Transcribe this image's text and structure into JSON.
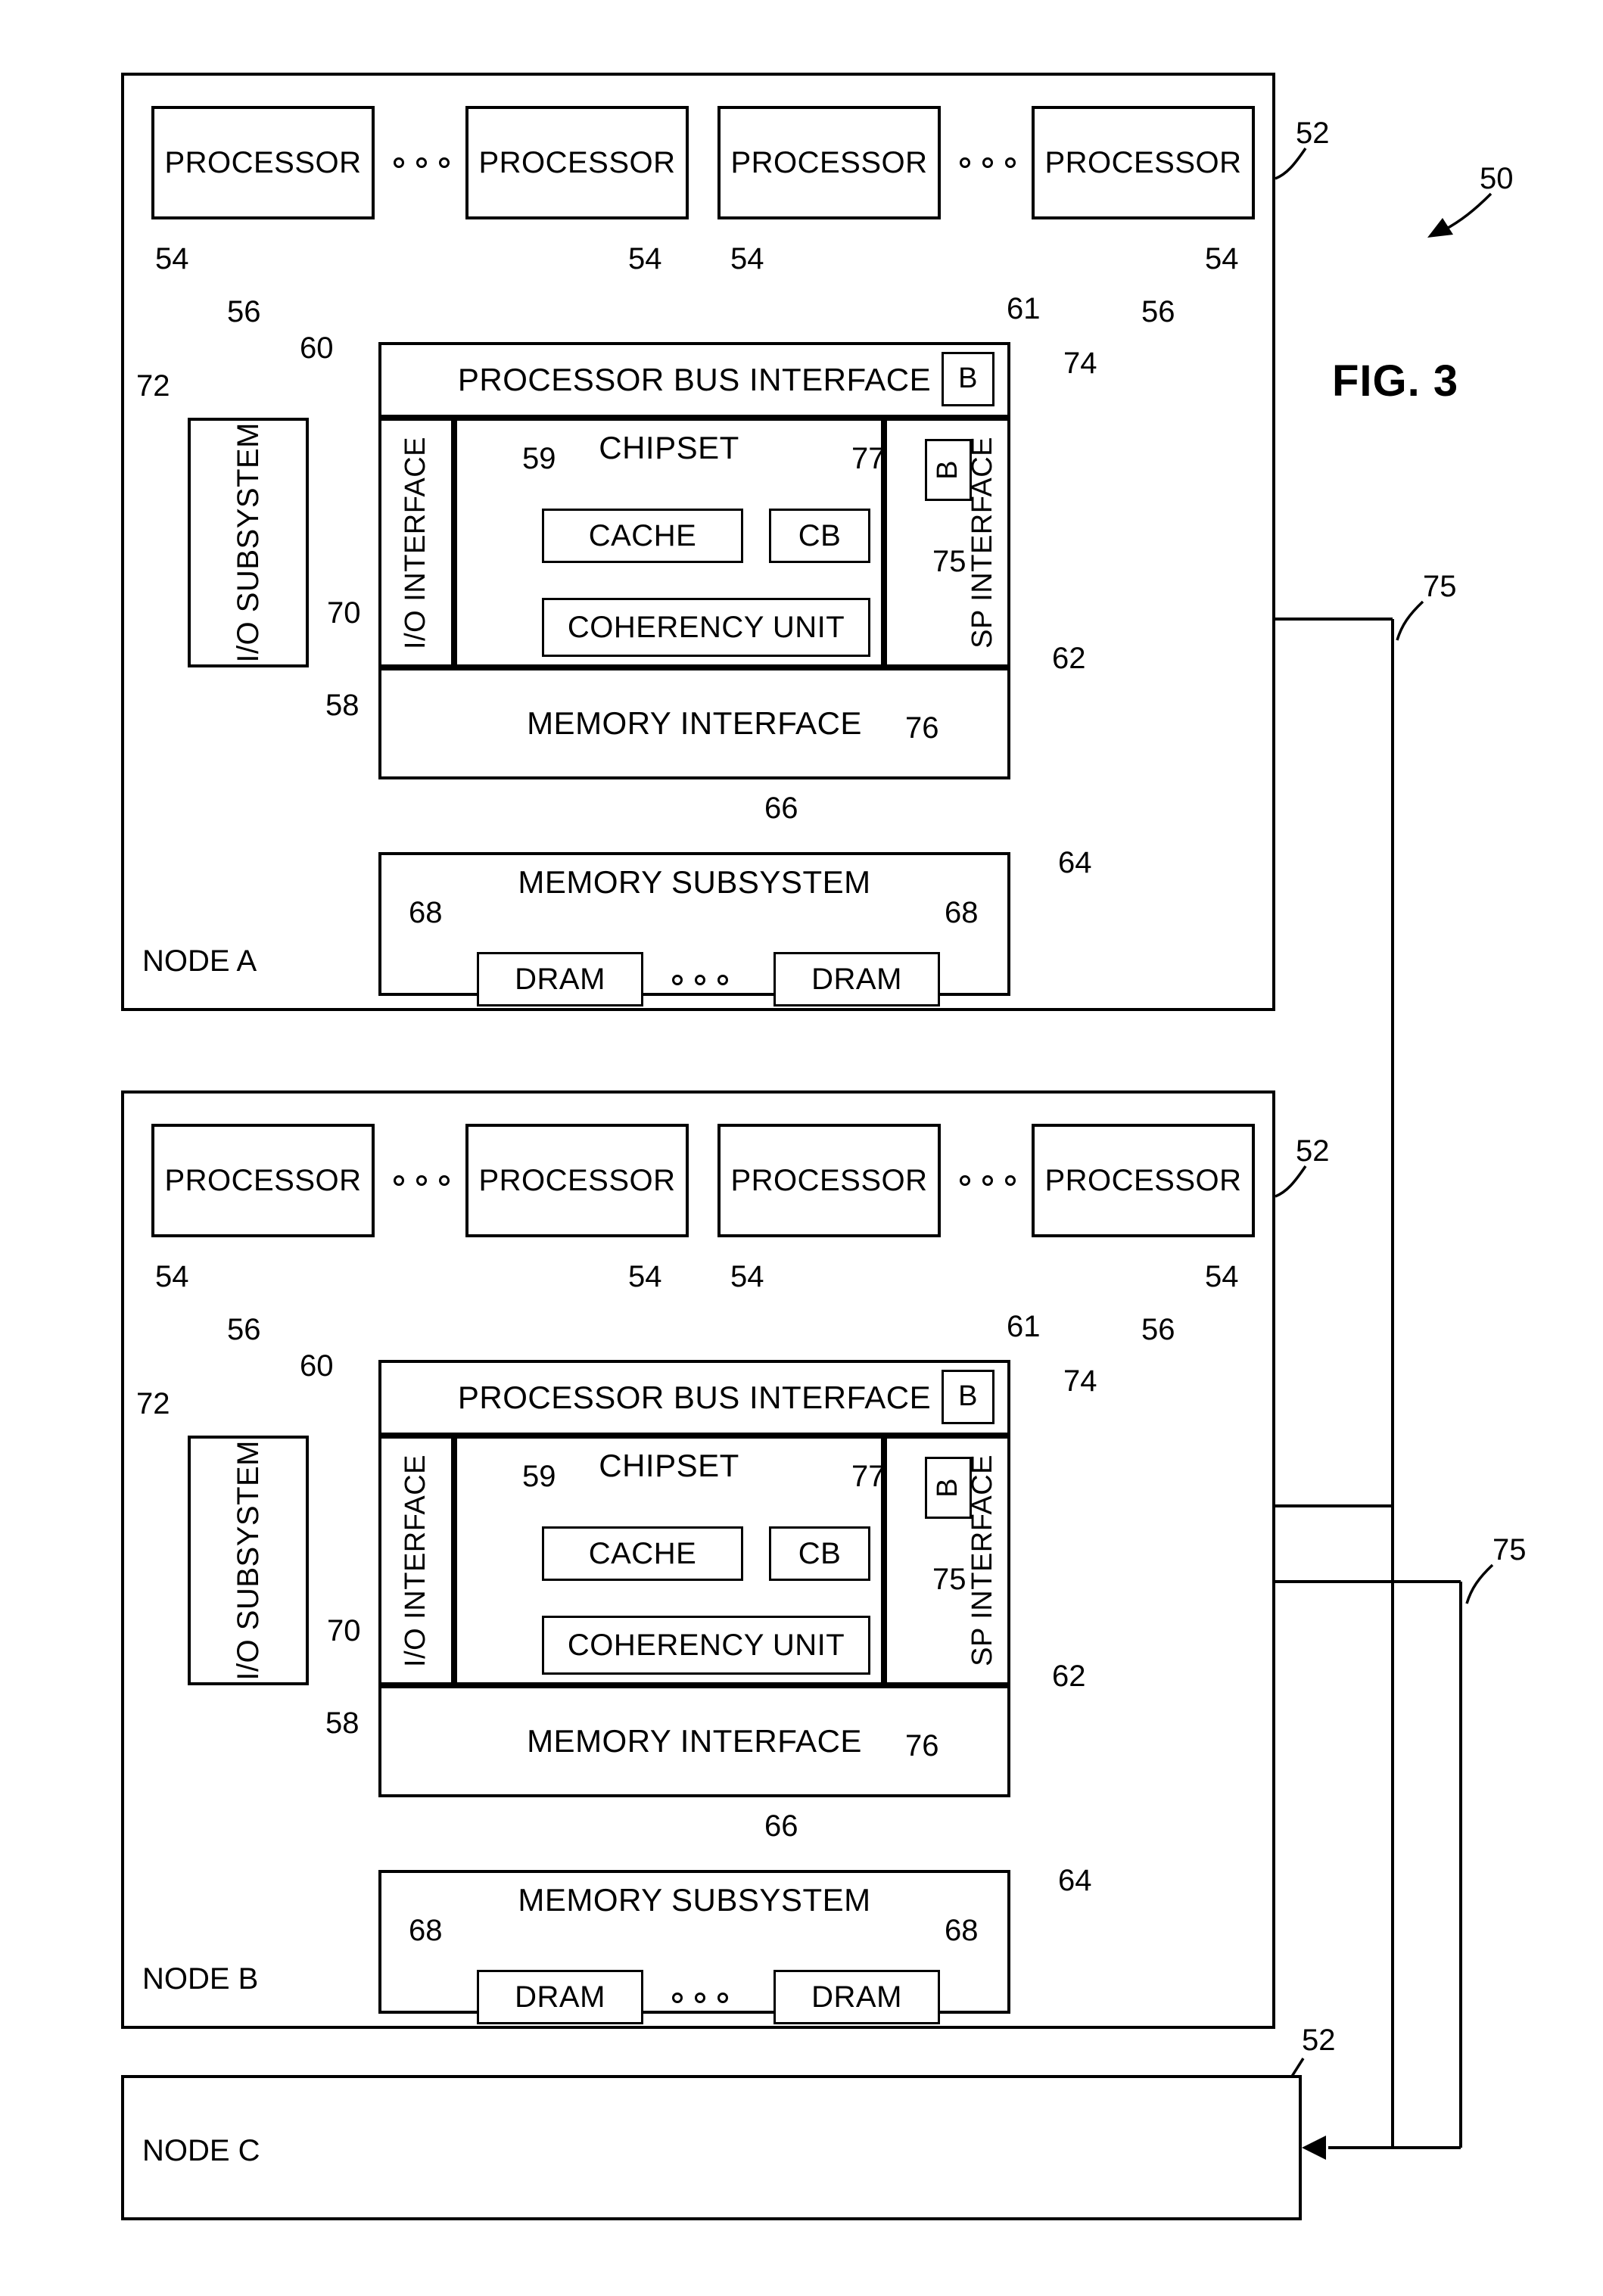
{
  "figure": {
    "title": "FIG. 3",
    "system_ref": "50"
  },
  "nodes": [
    {
      "name": "NODE A",
      "ref": "52",
      "processors": [
        {
          "label": "PROCESSOR",
          "ref": "54"
        },
        {
          "label": "PROCESSOR",
          "ref": "54"
        },
        {
          "label": "PROCESSOR",
          "ref": "54"
        },
        {
          "label": "PROCESSOR",
          "ref": "54"
        }
      ],
      "processor_ellipsis": "o o o",
      "bus_ref_left": "56",
      "bus_ref_right": "56",
      "bus_to_chipset_ref": "60",
      "chipset_container": {
        "processor_bus_interface": {
          "label": "PROCESSOR BUS INTERFACE",
          "ref": "61"
        },
        "buffer_top": {
          "label": "B",
          "ref": "74"
        },
        "io_interface": {
          "label": "I/O INTERFACE",
          "ref": "58"
        },
        "chipset": {
          "label": "CHIPSET",
          "cache": {
            "label": "CACHE",
            "ref": "59"
          },
          "cb": {
            "label": "CB",
            "ref": "77"
          },
          "coherency_unit": {
            "label": "COHERENCY UNIT",
            "ref": "76"
          }
        },
        "sp_interface": {
          "label": "SP INTERFACE",
          "ref": "62"
        },
        "buffer_sp": {
          "label": "B",
          "ref": "75"
        },
        "memory_interface": {
          "label": "MEMORY INTERFACE"
        }
      },
      "io_subsystem": {
        "label": "I/O SUBSYSTEM",
        "ref": "72",
        "link_ref": "70"
      },
      "memory_link_ref": "66",
      "memory_subsystem": {
        "label": "MEMORY SUBSYSTEM",
        "ref": "64",
        "drams": [
          {
            "label": "DRAM",
            "ref": "68"
          },
          {
            "label": "DRAM",
            "ref": "68"
          }
        ],
        "dram_ellipsis": "o o o"
      }
    },
    {
      "name": "NODE B",
      "ref": "52",
      "processors": [
        {
          "label": "PROCESSOR",
          "ref": "54"
        },
        {
          "label": "PROCESSOR",
          "ref": "54"
        },
        {
          "label": "PROCESSOR",
          "ref": "54"
        },
        {
          "label": "PROCESSOR",
          "ref": "54"
        }
      ],
      "processor_ellipsis": "o o o",
      "bus_ref_left": "56",
      "bus_ref_right": "56",
      "bus_to_chipset_ref": "60",
      "chipset_container": {
        "processor_bus_interface": {
          "label": "PROCESSOR BUS INTERFACE",
          "ref": "61"
        },
        "buffer_top": {
          "label": "B",
          "ref": "74"
        },
        "io_interface": {
          "label": "I/O INTERFACE",
          "ref": "58"
        },
        "chipset": {
          "label": "CHIPSET",
          "cache": {
            "label": "CACHE",
            "ref": "59"
          },
          "cb": {
            "label": "CB",
            "ref": "77"
          },
          "coherency_unit": {
            "label": "COHERENCY UNIT",
            "ref": "76"
          }
        },
        "sp_interface": {
          "label": "SP INTERFACE",
          "ref": "62"
        },
        "buffer_sp": {
          "label": "B",
          "ref": "75"
        },
        "memory_interface": {
          "label": "MEMORY INTERFACE"
        }
      },
      "io_subsystem": {
        "label": "I/O SUBSYSTEM",
        "ref": "72",
        "link_ref": "70"
      },
      "memory_link_ref": "66",
      "memory_subsystem": {
        "label": "MEMORY SUBSYSTEM",
        "ref": "64",
        "drams": [
          {
            "label": "DRAM",
            "ref": "68"
          },
          {
            "label": "DRAM",
            "ref": "68"
          }
        ],
        "dram_ellipsis": "o o o"
      }
    },
    {
      "name": "NODE C",
      "ref": "52"
    }
  ],
  "interconnect": {
    "links": [
      {
        "ref": "75"
      },
      {
        "ref": "75"
      }
    ]
  }
}
